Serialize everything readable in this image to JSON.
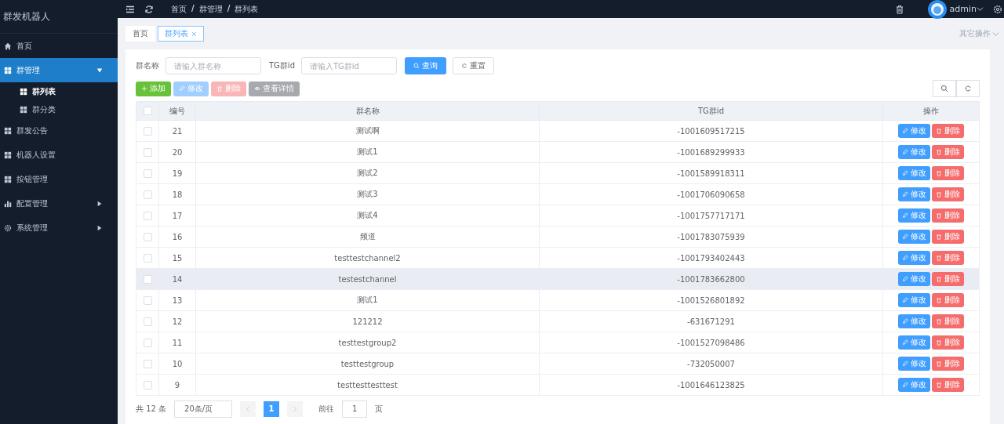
{
  "sidebar": {
    "title": "群发机器人",
    "items": [
      {
        "label": "首页",
        "kind": "home",
        "selected": false
      },
      {
        "label": "群管理",
        "kind": "grid",
        "selected": true,
        "expanded": true,
        "children": [
          {
            "label": "群列表",
            "selected": true
          },
          {
            "label": "群分类",
            "selected": false
          }
        ]
      },
      {
        "label": "群发公告",
        "kind": "grid",
        "selected": false
      },
      {
        "label": "机器人设置",
        "kind": "grid",
        "selected": false
      },
      {
        "label": "按钮管理",
        "kind": "grid",
        "selected": false
      },
      {
        "label": "配置管理",
        "kind": "chart",
        "selected": false,
        "expanded": false
      },
      {
        "label": "系统管理",
        "kind": "gear",
        "selected": false,
        "expanded": false
      }
    ]
  },
  "header": {
    "breadcrumb": [
      "首页",
      "群管理",
      "群列表"
    ],
    "separators": [
      "/",
      "/"
    ],
    "user": "admin"
  },
  "tabs": [
    {
      "label": "首页",
      "selected": false,
      "closable": false
    },
    {
      "label": "群列表",
      "selected": true,
      "closable": true
    }
  ],
  "other_actions": "其它操作",
  "search": {
    "fields": [
      {
        "label": "群名称",
        "placeholder": "请输入群名称"
      },
      {
        "label": "TG群id",
        "placeholder": "请输入TG群id"
      }
    ],
    "query": "查询",
    "reset": "重置"
  },
  "toolbar": [
    {
      "label": "添加",
      "kind": "add",
      "disabled": false
    },
    {
      "label": "修改",
      "kind": "edit",
      "disabled": true
    },
    {
      "label": "删除",
      "kind": "delete",
      "disabled": true
    },
    {
      "label": "查看详情",
      "kind": "view",
      "disabled": true
    }
  ],
  "table": {
    "select_all": {
      "checked": false
    },
    "columns": [
      "编号",
      "群名称",
      "TG群id",
      "操作"
    ],
    "rows": [
      {
        "id": "21",
        "name": "测试啊",
        "tg": "-1001609517215",
        "selected": false,
        "actions": [
          "修改",
          "删除"
        ]
      },
      {
        "id": "20",
        "name": "测试1",
        "tg": "-1001689299933",
        "selected": false,
        "actions": [
          "修改",
          "删除"
        ]
      },
      {
        "id": "19",
        "name": "测试2",
        "tg": "-1001589918311",
        "selected": false,
        "actions": [
          "修改",
          "删除"
        ]
      },
      {
        "id": "18",
        "name": "测试3",
        "tg": "-1001706090658",
        "selected": false,
        "actions": [
          "修改",
          "删除"
        ]
      },
      {
        "id": "17",
        "name": "测试4",
        "tg": "-1001757717171",
        "selected": false,
        "actions": [
          "修改",
          "删除"
        ]
      },
      {
        "id": "16",
        "name": "频道",
        "tg": "-1001783075939",
        "selected": false,
        "actions": [
          "修改",
          "删除"
        ]
      },
      {
        "id": "15",
        "name": "testtestchannel2",
        "tg": "-1001793402443",
        "selected": false,
        "actions": [
          "修改",
          "删除"
        ]
      },
      {
        "id": "14",
        "name": "testestchannel",
        "tg": "-1001783662800",
        "selected": true,
        "actions": [
          "修改",
          "删除"
        ]
      },
      {
        "id": "13",
        "name": "测试1",
        "tg": "-1001526801892",
        "selected": false,
        "actions": [
          "修改",
          "删除"
        ]
      },
      {
        "id": "12",
        "name": "121212",
        "tg": "-631671291",
        "selected": false,
        "actions": [
          "修改",
          "删除"
        ]
      },
      {
        "id": "11",
        "name": "testtestgroup2",
        "tg": "-1001527098486",
        "selected": false,
        "actions": [
          "修改",
          "删除"
        ]
      },
      {
        "id": "10",
        "name": "testtestgroup",
        "tg": "-732050007",
        "selected": false,
        "actions": [
          "修改",
          "删除"
        ]
      },
      {
        "id": "9",
        "name": "testtesttesttest",
        "tg": "-1001646123825",
        "selected": false,
        "actions": [
          "修改",
          "删除"
        ]
      }
    ]
  },
  "pagination": {
    "total": "共 12 条",
    "size": "20条/页",
    "pages": [
      {
        "label": "1",
        "selected": true
      }
    ],
    "goto": "前往",
    "page": "1",
    "suffix": "页"
  }
}
